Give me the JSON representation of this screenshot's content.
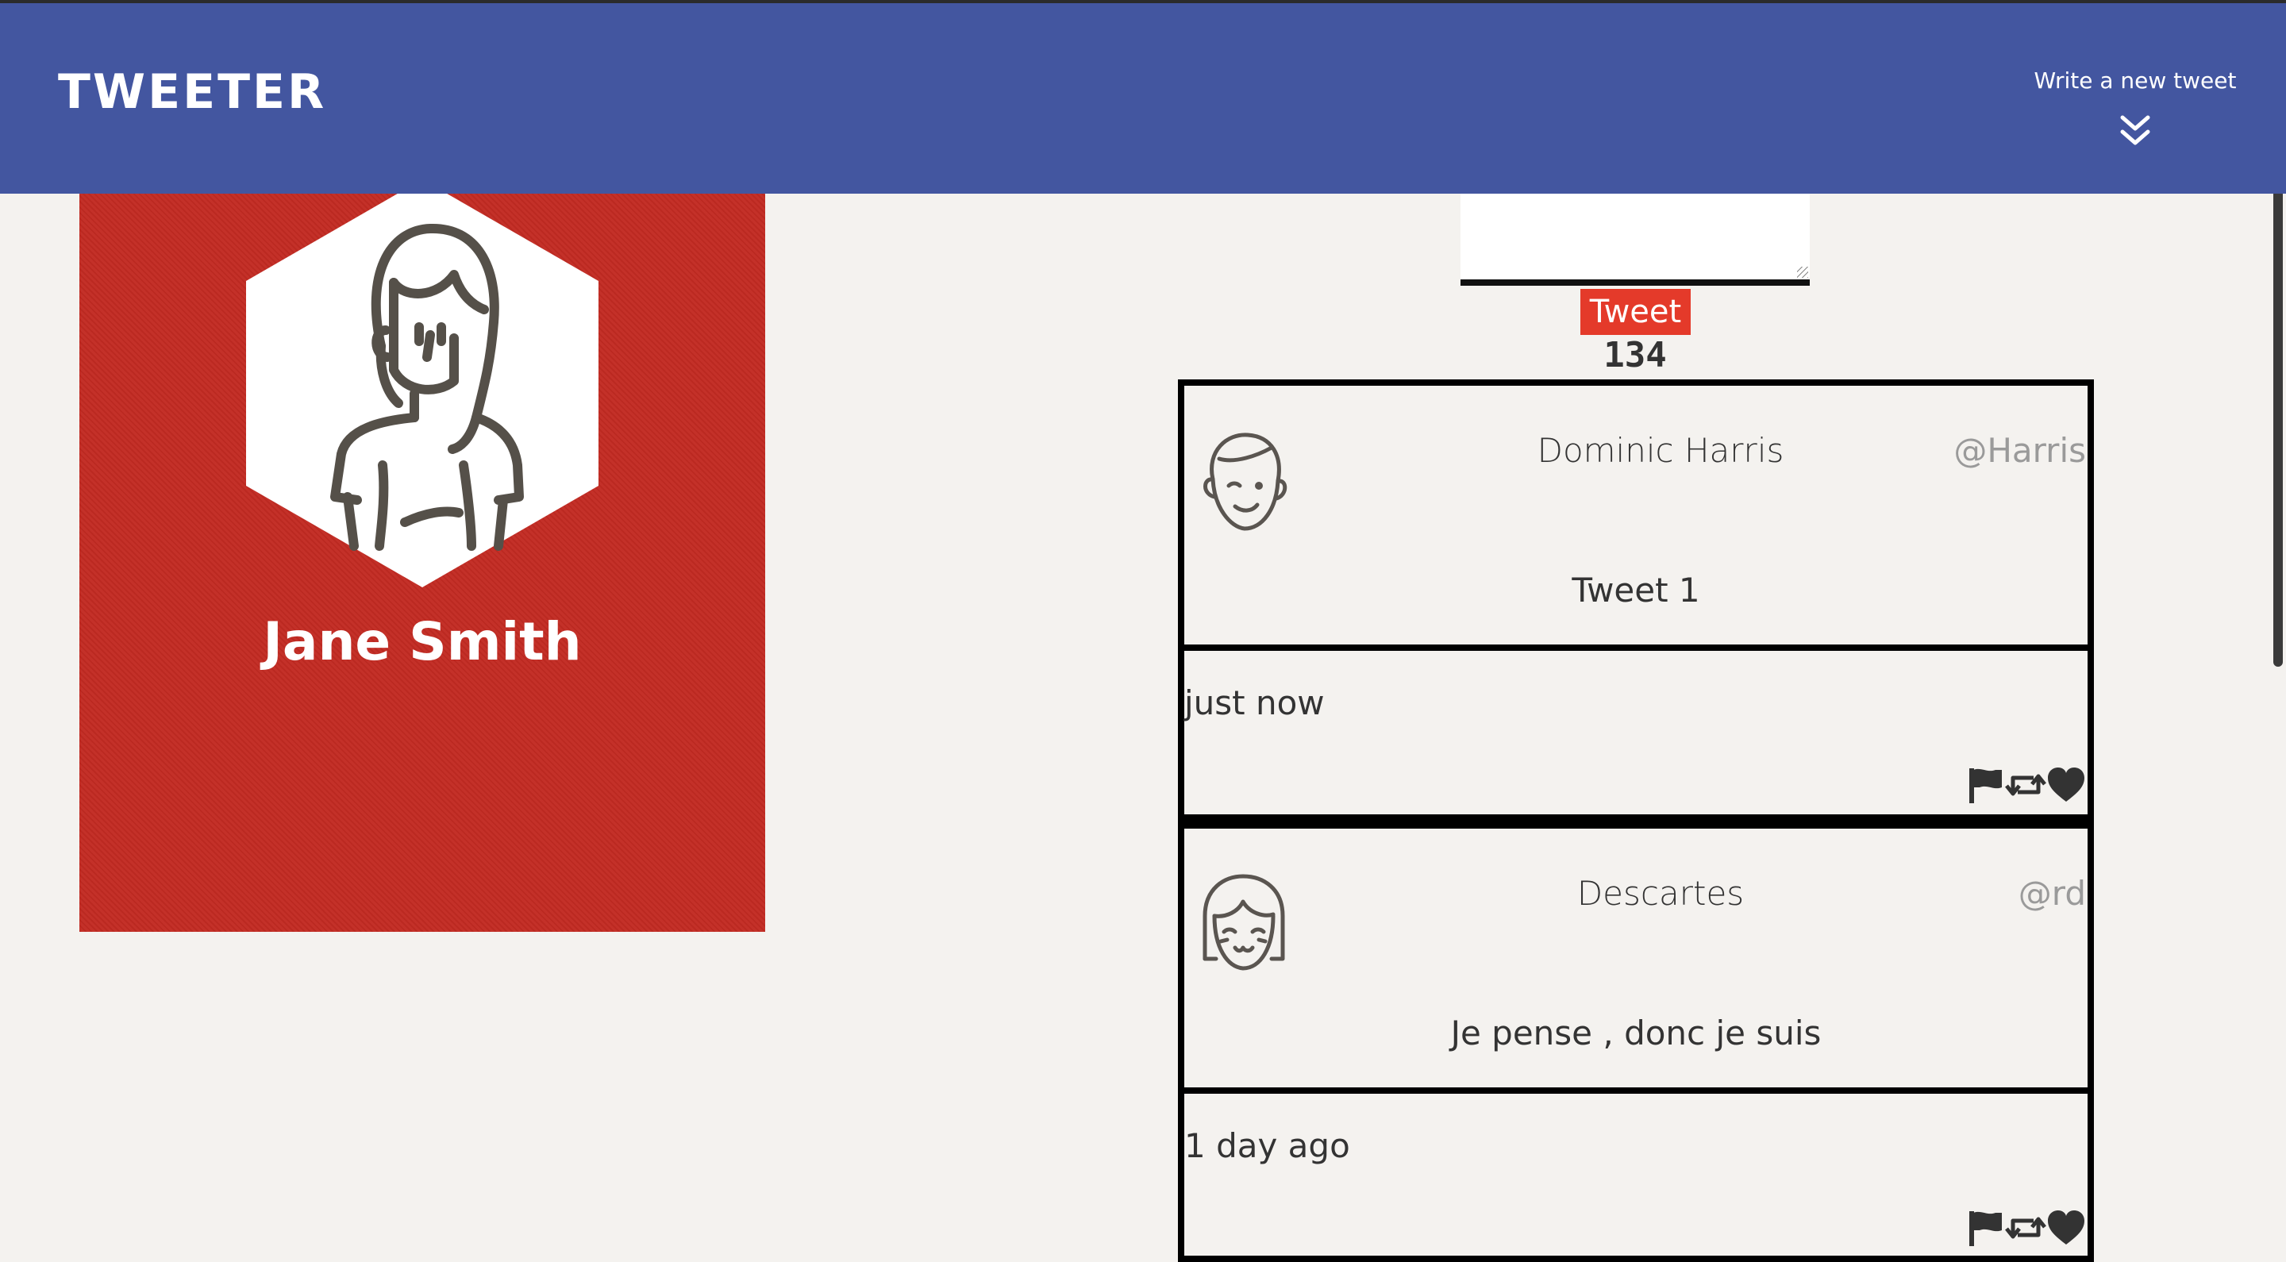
{
  "header": {
    "brand": "TWEETER",
    "compose_toggle_label": "Write a new tweet",
    "compose_toggle_icon": "double-chevron-down-icon",
    "background_color": "#4356a0"
  },
  "profile": {
    "name": "Jane Smith",
    "avatar_icon": "woman-avatar-icon",
    "card_color": "#c22a22"
  },
  "compose": {
    "textarea_value": "",
    "tweet_button_label": "Tweet",
    "char_counter": "134",
    "button_color": "#e43a2a"
  },
  "tweets": [
    {
      "author": "Dominic Harris",
      "handle": "@Harris",
      "text": "Tweet 1",
      "time": "just now",
      "avatar_icon": "man-avatar-icon",
      "actions": [
        "flag-icon",
        "retweet-icon",
        "heart-icon"
      ]
    },
    {
      "author": "Descartes",
      "handle": "@rd",
      "text": "Je pense , donc je suis",
      "time": "1 day ago",
      "avatar_icon": "girl-avatar-icon",
      "actions": [
        "flag-icon",
        "retweet-icon",
        "heart-icon"
      ]
    }
  ]
}
